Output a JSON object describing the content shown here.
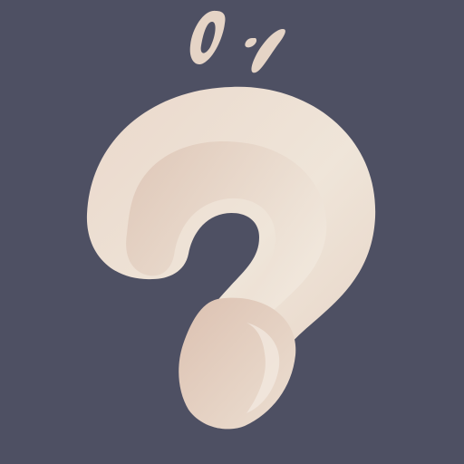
{
  "image": {
    "subject": "question-mark-icon",
    "colors": {
      "background": "#4e5063",
      "glyph_light": "#efe6da",
      "glyph_mid": "#e2cdbd",
      "glyph_shadow": "#c9a898",
      "accent": "#e5d4c6"
    }
  }
}
